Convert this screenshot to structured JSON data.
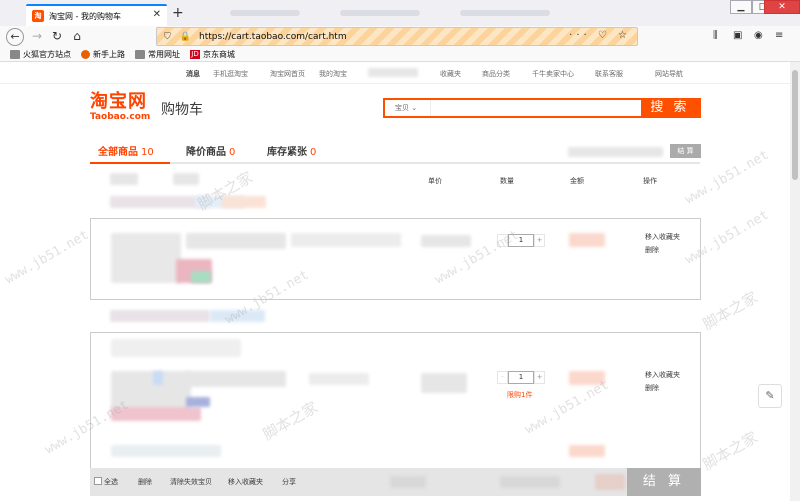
{
  "browser": {
    "tab_title": "淘宝网 - 我的购物车",
    "tab_favicon": "淘",
    "url": "https://cart.taobao.com/cart.htm",
    "bookmarks": [
      {
        "label": "火狐官方站点",
        "icon": "fire-icon"
      },
      {
        "label": "新手上路",
        "icon": "fire-icon"
      },
      {
        "label": "常用网址",
        "icon": "folder-icon"
      },
      {
        "label": "京东商城",
        "icon": "jd-icon"
      }
    ]
  },
  "site_nav": {
    "messages": "消息",
    "mobile": "手机逛淘宝",
    "home": "淘宝网首页",
    "my_taobao": "我的淘宝",
    "favorites": "收藏夹",
    "categories": "商品分类",
    "seller_center": "千牛卖家中心",
    "contact": "联系客服",
    "site_map": "网站导航"
  },
  "header": {
    "logo": "淘宝网",
    "logo_sub": "Taobao.com",
    "title": "购物车",
    "search_scope": "宝贝",
    "search_button": "搜 索"
  },
  "tabs": [
    {
      "label": "全部商品",
      "count": "10"
    },
    {
      "label": "降价商品",
      "count": "0"
    },
    {
      "label": "库存紧张",
      "count": "0"
    }
  ],
  "settle_mini": "结 算",
  "columns": {
    "price": "单价",
    "qty": "数量",
    "amount": "金额",
    "ops": "操作"
  },
  "items": [
    {
      "qty": "1",
      "move_fav": "移入收藏夹",
      "delete": "删除",
      "limit": ""
    },
    {
      "qty": "1",
      "move_fav": "移入收藏夹",
      "delete": "删除",
      "limit": "限购1件"
    }
  ],
  "footer": {
    "select_all": "全选",
    "delete": "删除",
    "clear_invalid": "清除失效宝贝",
    "move_fav": "移入收藏夹",
    "share": "分享",
    "checkout": "结 算"
  },
  "watermark": "www.jb51.net",
  "watermark_cn": "脚本之家",
  "colors": {
    "brand": "#ff4400",
    "search": "#ff5000"
  }
}
